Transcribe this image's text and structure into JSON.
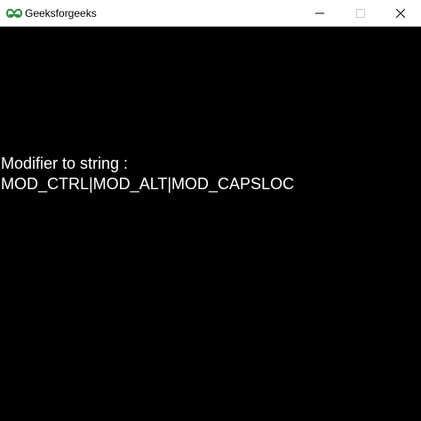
{
  "window": {
    "title": "Geeksforgeeks",
    "icon": "geeksforgeeks-logo-icon",
    "controls": [
      "minimize-icon",
      "maximize-icon",
      "close-icon"
    ],
    "accent_color": "#2f8d46",
    "background_color": "#000000",
    "text_color": "#ffffff"
  },
  "content": {
    "line1": "Modifier to string :",
    "line2": "MOD_CTRL|MOD_ALT|MOD_CAPSLOC"
  }
}
